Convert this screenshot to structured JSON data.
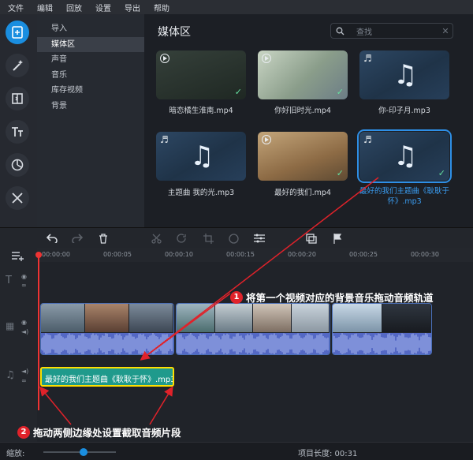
{
  "menu": [
    "文件",
    "编辑",
    "回放",
    "设置",
    "导出",
    "帮助"
  ],
  "subnav": [
    "导入",
    "媒体区",
    "声音",
    "音乐",
    "库存视频",
    "背景"
  ],
  "subnav_active": 1,
  "media": {
    "title": "媒体区",
    "search_placeholder": "查找",
    "items": [
      {
        "caption": "暗恋橘生淮南.mp4",
        "kind": "video",
        "checked": true
      },
      {
        "caption": "你好旧时光.mp4",
        "kind": "video",
        "checked": true
      },
      {
        "caption": "你-印子月.mp3",
        "kind": "audio",
        "checked": false
      },
      {
        "caption": "主题曲 我的光.mp3",
        "kind": "audio",
        "checked": false
      },
      {
        "caption": "最好的我们.mp4",
        "kind": "video",
        "checked": true
      },
      {
        "caption": "最好的我们主题曲《耿耿于怀》.mp3",
        "kind": "audio",
        "checked": true,
        "selected": true
      }
    ]
  },
  "timeline": {
    "ticks": [
      "00:00:00",
      "00:00:05",
      "00:00:10",
      "00:00:15",
      "00:00:20",
      "00:00:25",
      "00:00:30"
    ],
    "audio_clip_label": "最好的我们主题曲《耿耿于怀》.mp3"
  },
  "annotations": {
    "a1_num": "1",
    "a1_text": "将第一个视频对应的背景音乐拖动音频轨道",
    "a2_num": "2",
    "a2_text": "拖动两侧边缘处设置截取音频片段"
  },
  "footer": {
    "zoom_label": "缩放:",
    "length_label": "项目长度: 00:31",
    "zoom_level": 0.55
  },
  "colors": {
    "accent": "#1a8ee0",
    "annotation": "#e0222a",
    "audio_clip": "#1f9a8c",
    "clip_border_selected": "#ffdf00"
  }
}
